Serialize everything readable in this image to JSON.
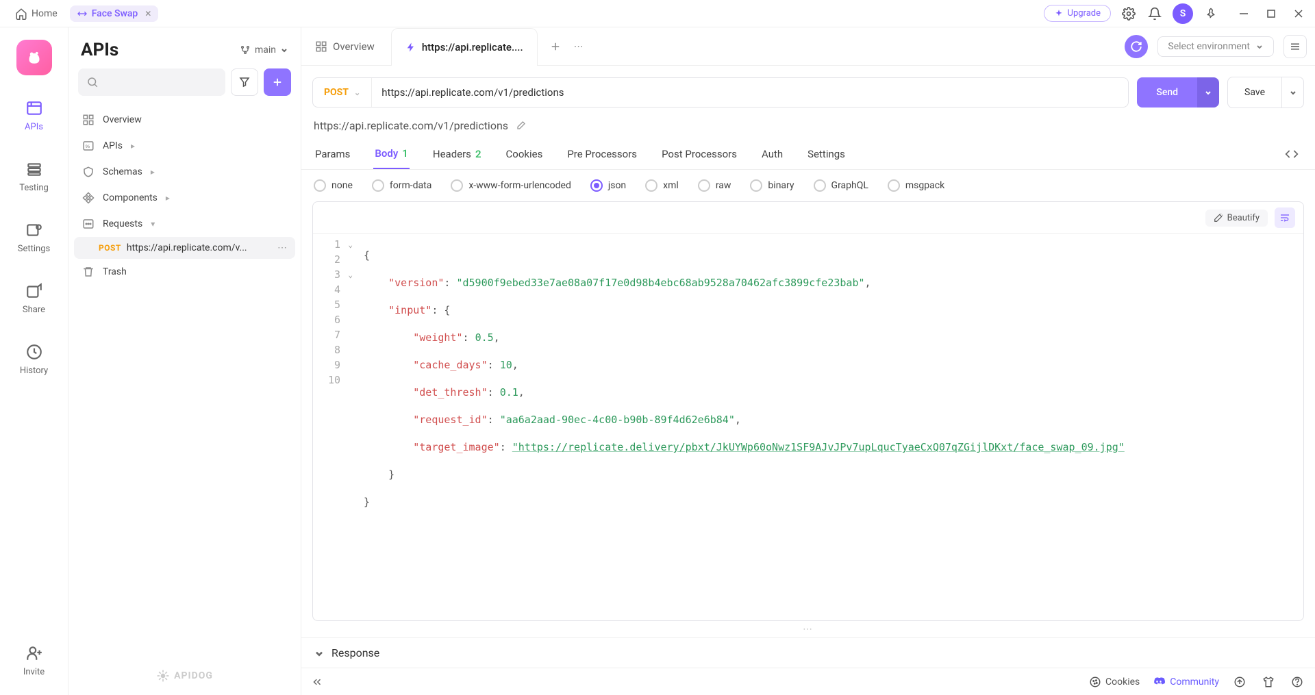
{
  "titlebar": {
    "home": "Home",
    "project_tab": "Face Swap",
    "upgrade": "Upgrade",
    "avatar_initial": "S"
  },
  "rail": {
    "items": [
      {
        "label": "APIs"
      },
      {
        "label": "Testing"
      },
      {
        "label": "Settings"
      },
      {
        "label": "Share"
      },
      {
        "label": "History"
      },
      {
        "label": "Invite"
      }
    ]
  },
  "sidebar": {
    "title": "APIs",
    "branch": "main",
    "tree": {
      "overview": "Overview",
      "apis": "APIs",
      "schemas": "Schemas",
      "components": "Components",
      "requests": "Requests",
      "trash": "Trash"
    },
    "request_item": {
      "method": "POST",
      "label": "https://api.replicate.com/v..."
    },
    "brand": "APIDOG"
  },
  "content": {
    "tabs": {
      "overview": "Overview",
      "active": "https://api.replicate...."
    },
    "env_placeholder": "Select environment",
    "request": {
      "method": "POST",
      "url": "https://api.replicate.com/v1/predictions",
      "send": "Send",
      "save": "Save",
      "name": "https://api.replicate.com/v1/predictions"
    },
    "section_tabs": {
      "params": "Params",
      "body": "Body",
      "body_badge": "1",
      "headers": "Headers",
      "headers_badge": "2",
      "cookies": "Cookies",
      "pre": "Pre Processors",
      "post": "Post Processors",
      "auth": "Auth",
      "settings": "Settings"
    },
    "body_types": {
      "none": "none",
      "formdata": "form-data",
      "xwww": "x-www-form-urlencoded",
      "json": "json",
      "xml": "xml",
      "raw": "raw",
      "binary": "binary",
      "graphql": "GraphQL",
      "msgpack": "msgpack"
    },
    "editor": {
      "beautify": "Beautify",
      "code": {
        "l1": "{",
        "l2_k": "\"version\"",
        "l2_v": "\"d5900f9ebed33e7ae08a07f17e0d98b4ebc68ab9528a70462afc3899cfe23bab\"",
        "l3_k": "\"input\"",
        "l4_k": "\"weight\"",
        "l4_v": "0.5",
        "l5_k": "\"cache_days\"",
        "l5_v": "10",
        "l6_k": "\"det_thresh\"",
        "l6_v": "0.1",
        "l7_k": "\"request_id\"",
        "l7_v": "\"aa6a2aad-90ec-4c00-b90b-89f4d62e6b84\"",
        "l8_k": "\"target_image\"",
        "l8_v": "\"https://replicate.delivery/pbxt/JkUYWp60oNwz1SF9AJvJPv7upLqucTyaeCxQ07qZGijlDKxt/face_swap_09.jpg\"",
        "l9": "    }",
        "l10": "}"
      }
    },
    "response": "Response"
  },
  "footer": {
    "cookies": "Cookies",
    "community": "Community"
  }
}
